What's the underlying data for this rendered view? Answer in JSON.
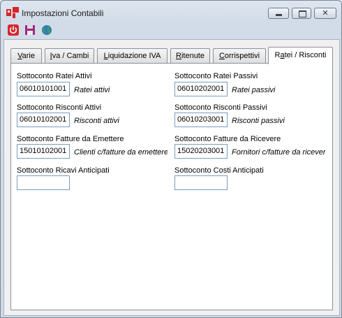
{
  "window": {
    "title": "Impostazioni Contabili",
    "controls": {
      "minimize": "min",
      "maximize": "max",
      "close": "✕"
    }
  },
  "toolbar": {
    "tools": [
      {
        "name": "power-icon",
        "color": "#d6272b"
      },
      {
        "name": "save-icon",
        "color": "#9c2a7c"
      },
      {
        "name": "globe-icon",
        "color": "#2e7bc4"
      }
    ]
  },
  "tabs": [
    {
      "label_pre": "",
      "label_u": "V",
      "label_post": "arie"
    },
    {
      "label_pre": "",
      "label_u": "I",
      "label_post": "va / Cambi"
    },
    {
      "label_pre": "",
      "label_u": "L",
      "label_post": "iquidazione IVA"
    },
    {
      "label_pre": "",
      "label_u": "R",
      "label_post": "itenute"
    },
    {
      "label_pre": "",
      "label_u": "C",
      "label_post": "orrispettivi"
    },
    {
      "label_pre": "R",
      "label_u": "a",
      "label_post": "tei / Risconti"
    }
  ],
  "active_tab": "Ratei / Risconti",
  "fields": {
    "ratei_attivi": {
      "label": "Sottoconto Ratei Attivi",
      "code": "06010101001",
      "description": "Ratei attivi"
    },
    "ratei_passivi": {
      "label": "Sottoconto Ratei Passivi",
      "code": "06010202001",
      "description": "Ratei passivi"
    },
    "risconti_attivi": {
      "label": "Sottoconto Risconti Attivi",
      "code": "06010102001",
      "description": "Risconti attivi"
    },
    "risconti_passivi": {
      "label": "Sottoconto Risconti Passivi",
      "code": "06010203001",
      "description": "Risconti passivi"
    },
    "fatture_emettere": {
      "label": "Sottoconto Fatture da Emettere",
      "code": "15010102001",
      "description": "Clienti c/fatture da emettere"
    },
    "fatture_ricevere": {
      "label": "Sottoconto Fatture da Ricevere",
      "code": "15020203001",
      "description": "Fornitori c/fatture da ricevere"
    },
    "ricavi_anticipati": {
      "label": "Sottoconto Ricavi Anticipati",
      "code": "",
      "description": ""
    },
    "costi_anticipati": {
      "label": "Sottoconto Costi Anticipati",
      "code": "",
      "description": ""
    }
  }
}
